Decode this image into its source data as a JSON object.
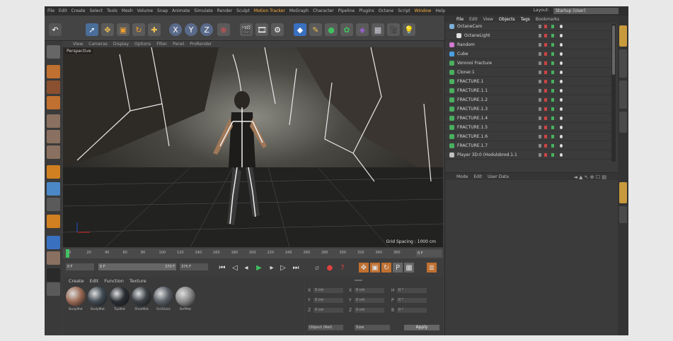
{
  "menubar": {
    "items": [
      {
        "label": "File",
        "hl": false
      },
      {
        "label": "Edit",
        "hl": false
      },
      {
        "label": "Create",
        "hl": false
      },
      {
        "label": "Select",
        "hl": false
      },
      {
        "label": "Tools",
        "hl": false
      },
      {
        "label": "Mesh",
        "hl": false
      },
      {
        "label": "Volume",
        "hl": false
      },
      {
        "label": "Snap",
        "hl": false
      },
      {
        "label": "Animate",
        "hl": false
      },
      {
        "label": "Simulate",
        "hl": false
      },
      {
        "label": "Render",
        "hl": false
      },
      {
        "label": "Sculpt",
        "hl": false
      },
      {
        "label": "Motion Tracker",
        "hl": true
      },
      {
        "label": "MoGraph",
        "hl": false
      },
      {
        "label": "Character",
        "hl": false
      },
      {
        "label": "Pipeline",
        "hl": false
      },
      {
        "label": "Plugins",
        "hl": false
      },
      {
        "label": "Octane",
        "hl": false
      },
      {
        "label": "Script",
        "hl": false
      },
      {
        "label": "Window",
        "hl": true
      },
      {
        "label": "Help",
        "hl": false
      }
    ],
    "layout_label": "Layout:",
    "layout_value": "Startup (User)"
  },
  "toolbar": {
    "axis_x": "X",
    "axis_y": "Y",
    "axis_z": "Z"
  },
  "viewport_menu": [
    "View",
    "Cameras",
    "Display",
    "Options",
    "Filter",
    "Panel",
    "ProRender"
  ],
  "viewport": {
    "label": "Perspective",
    "grid_spacing": "Grid Spacing : 1000 cm"
  },
  "timeline": {
    "ticks": [
      "0",
      "20",
      "40",
      "60",
      "80",
      "100",
      "120",
      "140",
      "160",
      "180",
      "200",
      "220",
      "240",
      "260",
      "280",
      "300",
      "320",
      "340",
      "360"
    ],
    "end_field": "0 F"
  },
  "playbar": {
    "start_field": "0 F",
    "range_start": "0 F",
    "range_end": "370 F",
    "end_field": "370 F"
  },
  "material_menu": [
    "Create",
    "Edit",
    "Function",
    "Texture"
  ],
  "materials": [
    {
      "name": "BodyMat",
      "color": "#9a6a55"
    },
    {
      "name": "BodyMat",
      "color": "#404a52"
    },
    {
      "name": "TopMat",
      "color": "#2a2f35"
    },
    {
      "name": "ShoeMat",
      "color": "#3a3f44"
    },
    {
      "name": "OctGlass",
      "color": "#5a5f66"
    },
    {
      "name": "DefMat",
      "color": "#8a8a8a"
    }
  ],
  "coords": {
    "rows": [
      {
        "axis": "X",
        "pos": "0 cm",
        "mid": "X",
        "size": "0 cm",
        "rot_axis": "H",
        "rot": "0 °"
      },
      {
        "axis": "Y",
        "pos": "0 cm",
        "mid": "Y",
        "size": "0 cm",
        "rot_axis": "P",
        "rot": "0 °"
      },
      {
        "axis": "Z",
        "pos": "0 cm",
        "mid": "Z",
        "size": "0 cm",
        "rot_axis": "B",
        "rot": "0 °"
      }
    ],
    "mode1": "Object (Rel)",
    "mode2": "Size",
    "apply_label": "Apply"
  },
  "object_manager": {
    "menu": [
      {
        "label": "File",
        "hl": true
      },
      {
        "label": "Edit",
        "hl": false
      },
      {
        "label": "View",
        "hl": false
      },
      {
        "label": "Objects",
        "hl": true
      },
      {
        "label": "Tags",
        "hl": true
      },
      {
        "label": "Bookmarks",
        "hl": false
      }
    ],
    "objects": [
      {
        "name": "OctaneCam",
        "indent": 0,
        "icon_color": "#7ab0d8"
      },
      {
        "name": "OctaneLight",
        "indent": 1,
        "icon_color": "#e0e0e0"
      },
      {
        "name": "Random",
        "indent": 0,
        "icon_color": "#d07ad0"
      },
      {
        "name": "Cube",
        "indent": 0,
        "icon_color": "#4aa0e0"
      },
      {
        "name": "Voronoi Fracture",
        "indent": 0,
        "icon_color": "#4ab060"
      },
      {
        "name": "Cloner.1",
        "indent": 0,
        "icon_color": "#4ab060"
      },
      {
        "name": "FRACTURE.1",
        "indent": 0,
        "icon_color": "#4ab060"
      },
      {
        "name": "FRACTURE.1.1",
        "indent": 0,
        "icon_color": "#4ab060"
      },
      {
        "name": "FRACTURE.1.2",
        "indent": 0,
        "icon_color": "#4ab060"
      },
      {
        "name": "FRACTURE.1.3",
        "indent": 0,
        "icon_color": "#4ab060"
      },
      {
        "name": "FRACTURE.1.4",
        "indent": 0,
        "icon_color": "#4ab060"
      },
      {
        "name": "FRACTURE.1.5",
        "indent": 0,
        "icon_color": "#4ab060"
      },
      {
        "name": "FRACTURE.1.6",
        "indent": 0,
        "icon_color": "#4ab060"
      },
      {
        "name": "FRACTURE.1.7",
        "indent": 0,
        "icon_color": "#4ab060"
      },
      {
        "name": "Player 3D:0 (Hodulsbrod.1.1",
        "indent": 0,
        "icon_color": "#c0c0c0"
      }
    ]
  },
  "attribute_manager": {
    "menu": [
      "Mode",
      "Edit",
      "User Data"
    ]
  },
  "colors": {
    "accent": "#ffb040",
    "panel": "#3b3b3b",
    "viewport_bg": "#2a2a2a"
  }
}
